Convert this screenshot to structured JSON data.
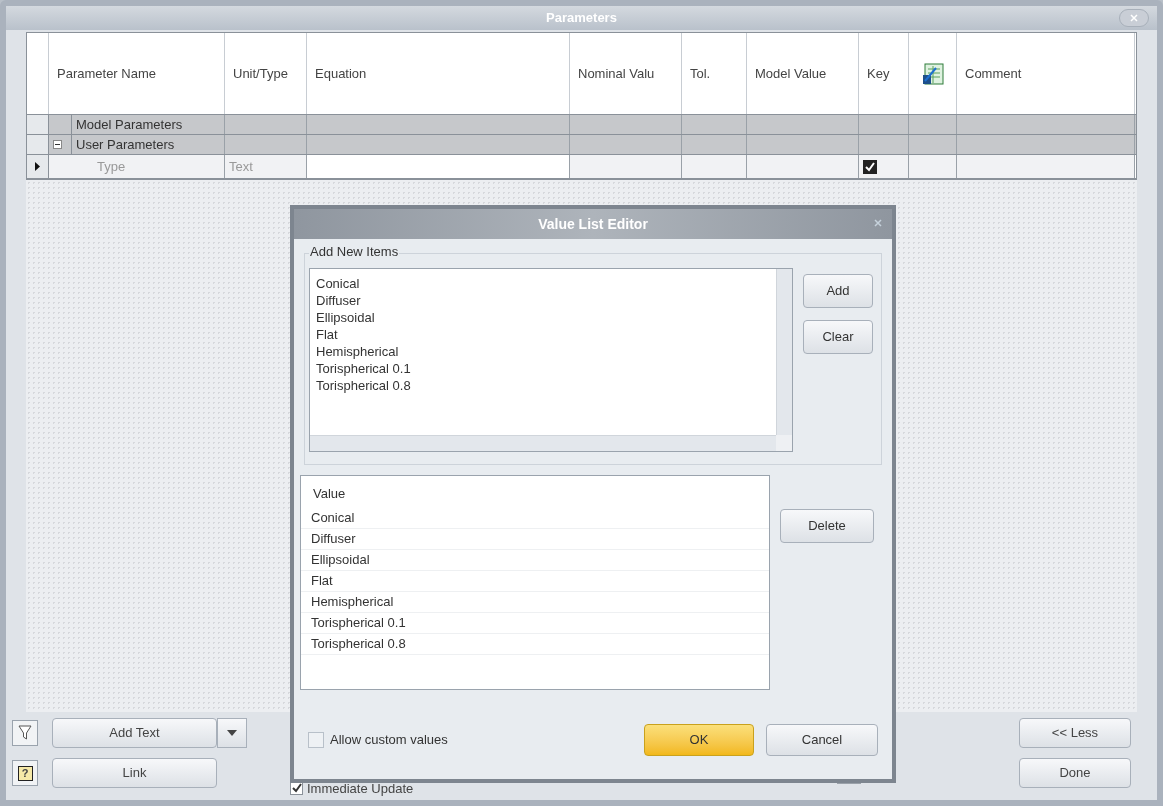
{
  "window": {
    "title": "Parameters"
  },
  "table": {
    "columns": [
      {
        "label": "Parameter Name"
      },
      {
        "label": "Unit/Type"
      },
      {
        "label": "Equation"
      },
      {
        "label": "Nominal Valu"
      },
      {
        "label": "Tol."
      },
      {
        "label": "Model Value"
      },
      {
        "label": "Key"
      },
      {
        "kind": "icon"
      },
      {
        "label": "Comment"
      }
    ],
    "rows": [
      {
        "kind": "group",
        "label": "Model Parameters",
        "current": false
      },
      {
        "kind": "group",
        "label": "User Parameters",
        "expanded": true,
        "current": false
      },
      {
        "kind": "parameter",
        "label": "Type",
        "unit": "Text",
        "key": true,
        "current": true
      }
    ]
  },
  "dialog": {
    "title": "Value List Editor",
    "group_label": "Add New Items",
    "new_items": [
      "Conical",
      "Diffuser",
      "Ellipsoidal",
      "Flat",
      "Hemispherical",
      "Torispherical 0.1",
      "Torispherical 0.8"
    ],
    "add_button": "Add",
    "clear_button": "Clear",
    "value_header": "Value",
    "values": [
      "Conical",
      "Diffuser",
      "Ellipsoidal",
      "Flat",
      "Hemispherical",
      "Torispherical 0.1",
      "Torispherical 0.8"
    ],
    "delete_button": "Delete",
    "allow_custom_values": {
      "label": "Allow custom values",
      "checked": false
    },
    "ok_button": "OK",
    "cancel_button": "Cancel"
  },
  "bottom": {
    "help_glyph": "?",
    "add_text": "Add Text",
    "link": "Link",
    "immediate_update": {
      "label": "Immediate Update",
      "checked": true
    },
    "less_button": "<< Less",
    "done_button": "Done"
  }
}
